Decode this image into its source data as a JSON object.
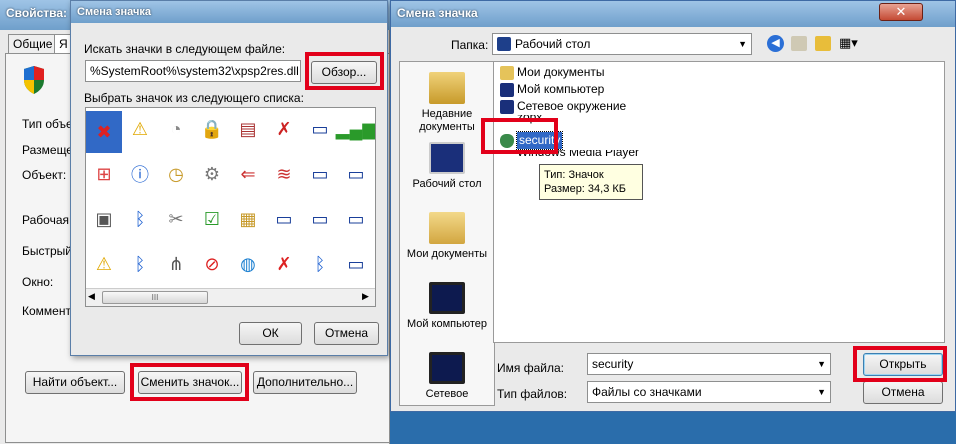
{
  "props": {
    "title": "Свойства: Ll",
    "tabs": [
      "Общие",
      "Я"
    ],
    "labels": [
      "Тип объе",
      "Размещен",
      "Объект:",
      "Рабочая п",
      "Быстрый",
      "Окно:",
      "Коммента"
    ],
    "find_button": "Найти объект...",
    "change_icon_button": "Сменить значок...",
    "more_button": "Дополнительно..."
  },
  "change_icon": {
    "title": "Смена значка",
    "search_label": "Искать значки в следующем файле:",
    "file_path": "%SystemRoot%\\system32\\xpsp2res.dll",
    "browse_button": "Обзор...",
    "list_label": "Выбрать значок из следующего списка:",
    "ok_button": "ОК",
    "cancel_button": "Отмена",
    "icons": [
      "delete-x-icon",
      "warning-icon",
      "satellite-dish-icon",
      "lock-icon",
      "document-icon",
      "network-cross-icon",
      "wireless-monitor-icon",
      "signal-bars-icon",
      "windows-flag-icon",
      "info-icon",
      "folder-clock-icon",
      "gears-icon",
      "arrow-left-icon",
      "wifi-device-icon",
      "monitor-pair-icon",
      "monitor-pair-icon",
      "computer-shield-icon",
      "bluetooth-icon",
      "tools-icon",
      "checklist-icon",
      "network-folder-icon",
      "wireless-monitor-icon",
      "wireless-monitor-icon",
      "monitor-pair-icon",
      "warning-icon",
      "bluetooth-icon",
      "tree-icon",
      "no-entry-icon",
      "globe-icon",
      "monitor-cross-icon",
      "bluetooth-small-icon",
      "monitor-pair-icon"
    ],
    "scroll_thumb": "III"
  },
  "file_dialog": {
    "title": "Смена значка",
    "folder_label": "Папка:",
    "folder_value": "Рабочий стол",
    "places": [
      "Недавние документы",
      "Рабочий стол",
      "Мои документы",
      "Мой компьютер",
      "Сетевое"
    ],
    "files": [
      "Мои документы",
      "Мой компьютер",
      "Сетевое окружение",
      "zорх",
      "security",
      "Windows Media Player"
    ],
    "tooltip_type": "Тип: Значок",
    "tooltip_size": "Размер: 34,3 КБ",
    "filename_label": "Имя файла:",
    "filename_value": "security",
    "filetype_label": "Тип файлов:",
    "filetype_value": "Файлы со значками",
    "open_button": "Открыть",
    "cancel_button": "Отмена"
  },
  "colors": {
    "accent_red": "#e2001a",
    "selection": "#3169c6"
  }
}
